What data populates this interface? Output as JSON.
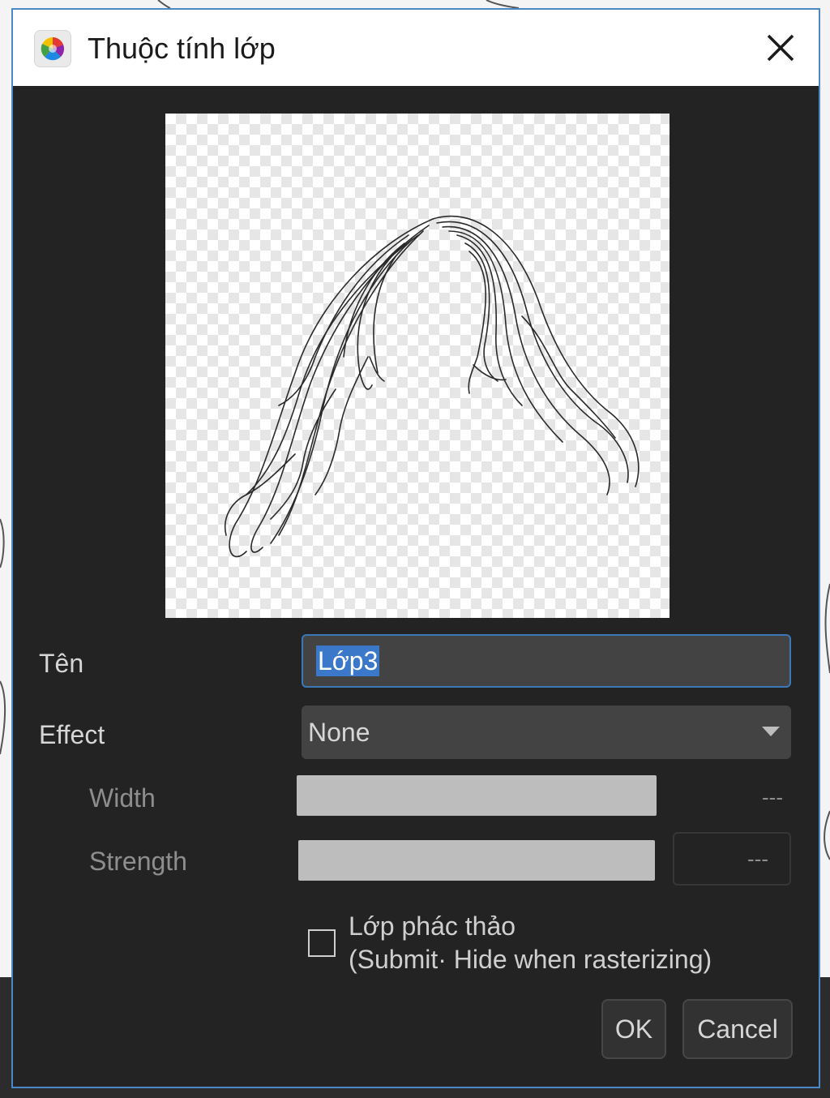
{
  "dialog": {
    "title": "Thuộc tính lớp",
    "app_icon": "color-wheel-icon",
    "close_icon": "close-icon"
  },
  "preview": {
    "description_icon": "layer-preview-hair-sketch"
  },
  "fields": {
    "name_label": "Tên",
    "name_value": "Lớp3",
    "effect_label": "Effect",
    "effect_value": "None",
    "width_label": "Width",
    "width_value": "---",
    "strength_label": "Strength",
    "strength_value": "---"
  },
  "draft": {
    "label_line1": "Lớp phác thảo",
    "label_line2": "(Submit· Hide when rasterizing)",
    "checked": false
  },
  "buttons": {
    "ok": "OK",
    "cancel": "Cancel"
  },
  "colors": {
    "accent": "#3b78c9",
    "dialog_bg": "#232323",
    "field_bg": "#434343"
  }
}
